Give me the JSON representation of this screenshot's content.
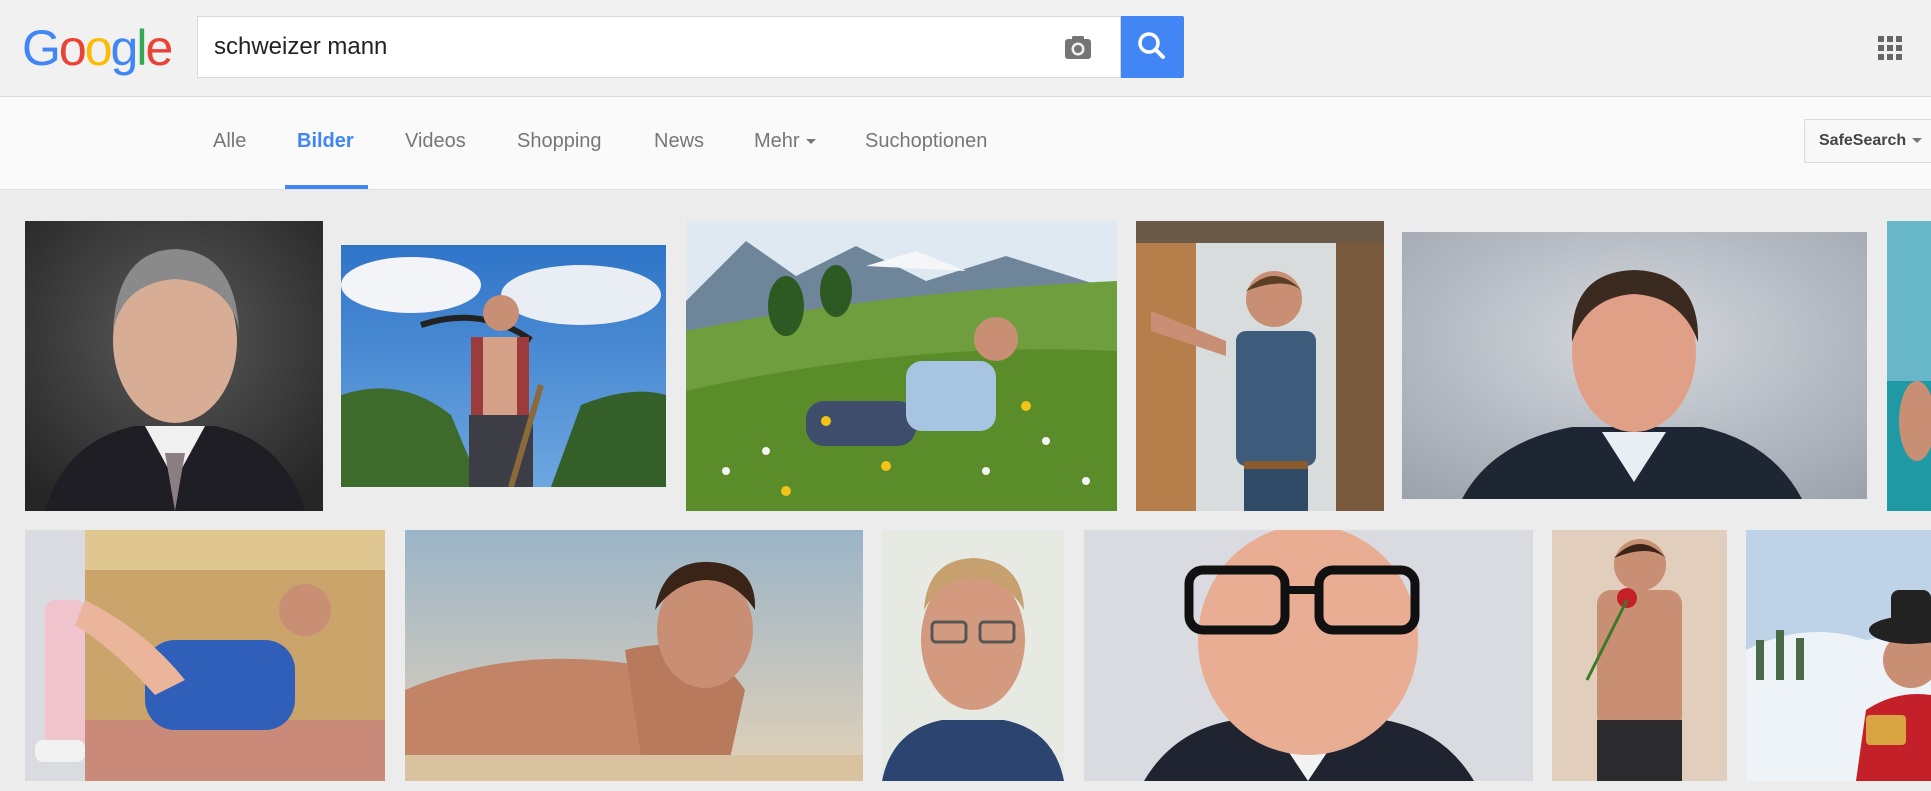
{
  "logo": {
    "letters": [
      "G",
      "o",
      "o",
      "g",
      "l",
      "e"
    ]
  },
  "search": {
    "value": "schweizer mann"
  },
  "colors": {
    "accent": "#4285f4",
    "logo": [
      "#4285f4",
      "#ea4335",
      "#fbbc05",
      "#4285f4",
      "#34a853",
      "#ea4335"
    ]
  },
  "icons": {
    "camera": "camera-icon",
    "search": "search-icon",
    "apps": "apps-grid-icon"
  },
  "nav": {
    "tabs": [
      {
        "label": "Alle"
      },
      {
        "label": "Bilder",
        "active": true
      },
      {
        "label": "Videos"
      },
      {
        "label": "Shopping"
      },
      {
        "label": "News"
      },
      {
        "label": "Mehr"
      },
      {
        "label": "Suchoptionen"
      }
    ],
    "safesearch": "SafeSearch"
  }
}
